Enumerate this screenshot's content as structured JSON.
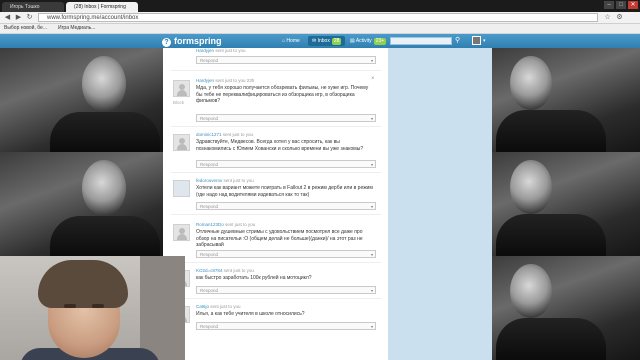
{
  "browser": {
    "tabs": [
      {
        "label": "Игорь Тэшко"
      },
      {
        "label": "(28) Inbox | Formspring"
      }
    ],
    "url": "www.formspring.me/account/inbox",
    "bookmarks": [
      {
        "label": "Выбор новой, бе..."
      },
      {
        "label": "Игра Медиаль..."
      }
    ]
  },
  "header": {
    "logo": "formspring",
    "nav": [
      {
        "label": "Home"
      },
      {
        "label": "Inbox",
        "badge": "28"
      },
      {
        "label": "Activity",
        "badge": "23+"
      }
    ],
    "search_placeholder": ""
  },
  "questions": [
    {
      "user": "Hardyjen",
      "time": "sent just to you",
      "text": "",
      "answer_placeholder": "Respond"
    },
    {
      "user": "Hardyjen",
      "time": "sent just to you 23h",
      "text": "Мда, у тебя хорошо получается обозревать фильмы, не хуже игр. Почему бы тебе не переквалифицироваться из обзорщика игр, в обзорщика фильмов?",
      "answer_placeholder": "Respond",
      "block_label": "Block"
    },
    {
      "user": "dominic1271",
      "time": "sent just to you",
      "text": "Здравствуйте, Медвесов. Всегда хотел у вас спросить, как вы познакомились с Юлием Ховански и сколько времени вы уже знакомы?",
      "answer_placeholder": "Respond"
    },
    {
      "user": "fedorouverov",
      "time": "sent just to you",
      "text": "Хотели как вариант можете поиграть в Fallout 2 в режим дерби или в режим (где надо над водителями издеваться как то так)",
      "answer_placeholder": "Respond"
    },
    {
      "user": "Roman123Do",
      "time": "sent just to you",
      "text": "Отличные душевные стримы с удовольствием посмотрел все даже про обзор на писательи :О (общем делай не больше)(данки)/ на этот раз не забрасывай",
      "answer_placeholder": "Respond"
    },
    {
      "user": "KO2d=c8784",
      "time": "sent just to you",
      "text": "как быстро заработать 100к рублей на мотоцикл?",
      "answer_placeholder": "Respond"
    },
    {
      "user": "Cat6jo",
      "time": "sent just to you",
      "text": "Илья, а как тебе учителя в школе относились?",
      "answer_placeholder": "Respond"
    }
  ],
  "colors": {
    "brand": "#3d8fbf",
    "sidebar": "#cbe0ee",
    "badge": "#8fd14f"
  }
}
